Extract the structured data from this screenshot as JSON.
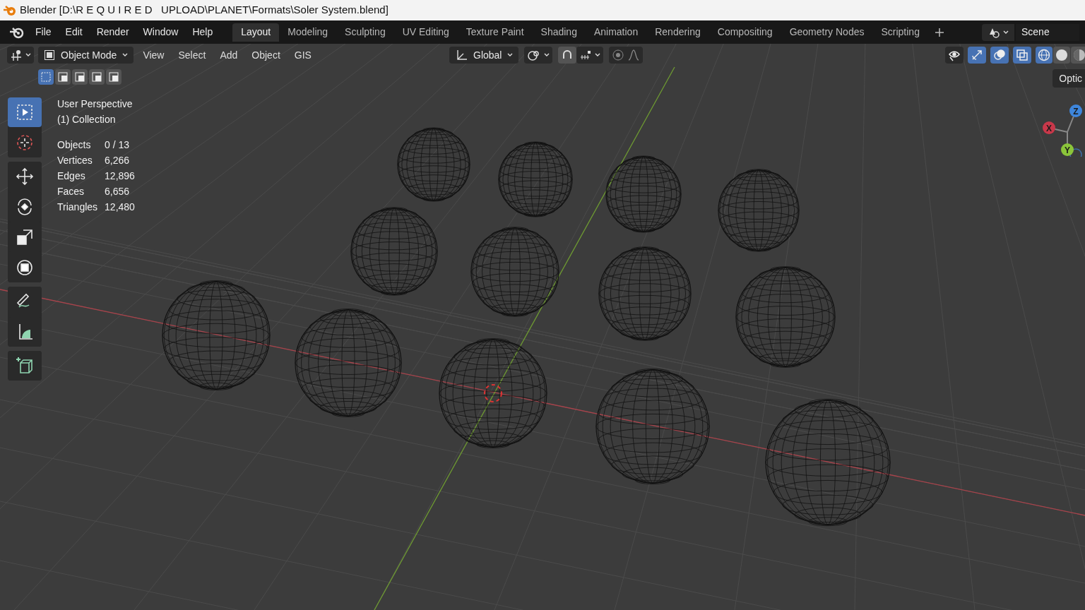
{
  "window": {
    "title": "Blender [D:\\R E Q U I R E D   UPLOAD\\PLANET\\Formats\\Soler System.blend]"
  },
  "menu": [
    "File",
    "Edit",
    "Render",
    "Window",
    "Help"
  ],
  "workspace_tabs": [
    {
      "label": "Layout",
      "selected": true
    },
    {
      "label": "Modeling",
      "selected": false
    },
    {
      "label": "Sculpting",
      "selected": false
    },
    {
      "label": "UV Editing",
      "selected": false
    },
    {
      "label": "Texture Paint",
      "selected": false
    },
    {
      "label": "Shading",
      "selected": false
    },
    {
      "label": "Animation",
      "selected": false
    },
    {
      "label": "Rendering",
      "selected": false
    },
    {
      "label": "Compositing",
      "selected": false
    },
    {
      "label": "Geometry Nodes",
      "selected": false
    },
    {
      "label": "Scripting",
      "selected": false
    }
  ],
  "scene": {
    "value": "Scene"
  },
  "header": {
    "mode": "Object Mode",
    "menus": [
      "View",
      "Select",
      "Add",
      "Object",
      "GIS"
    ],
    "orientation": "Global"
  },
  "viewport_toggles": [
    {
      "kind": "visibility",
      "on": false
    },
    {
      "kind": "gizmo",
      "on": true
    },
    {
      "kind": "overlay",
      "on": true
    },
    {
      "kind": "xray",
      "on": true
    }
  ],
  "shading_modes": [
    {
      "kind": "wireframe",
      "selected": true
    },
    {
      "kind": "solid",
      "selected": false
    },
    {
      "kind": "material",
      "selected": false
    }
  ],
  "select_modes": [
    {
      "selected": true
    },
    {
      "selected": false
    },
    {
      "selected": false
    },
    {
      "selected": false
    },
    {
      "selected": false
    }
  ],
  "options_button": "Optic",
  "overlay": {
    "view": "User Perspective",
    "collection": "(1) Collection"
  },
  "stats": [
    {
      "label": "Objects",
      "value": "0 / 13"
    },
    {
      "label": "Vertices",
      "value": "6,266"
    },
    {
      "label": "Edges",
      "value": "12,896"
    },
    {
      "label": "Faces",
      "value": "6,656"
    },
    {
      "label": "Triangles",
      "value": "12,480"
    }
  ],
  "tool_groups": [
    {
      "tools": [
        {
          "kind": "select",
          "selected": true
        },
        {
          "kind": "cursor",
          "selected": false
        }
      ]
    },
    {
      "tools": [
        {
          "kind": "move",
          "selected": false
        },
        {
          "kind": "rotate",
          "selected": false
        },
        {
          "kind": "scale",
          "selected": false
        },
        {
          "kind": "transform",
          "selected": false
        }
      ]
    },
    {
      "tools": [
        {
          "kind": "annotate",
          "selected": false
        },
        {
          "kind": "measure",
          "selected": false
        }
      ]
    },
    {
      "tools": [
        {
          "kind": "add_cube",
          "selected": false
        }
      ]
    }
  ],
  "gizmo": [
    {
      "label": "X",
      "color": "#c9384a"
    },
    {
      "label": "Z",
      "color": "#3e86dc"
    },
    {
      "label": "Y",
      "color": "#8bc53a"
    }
  ]
}
